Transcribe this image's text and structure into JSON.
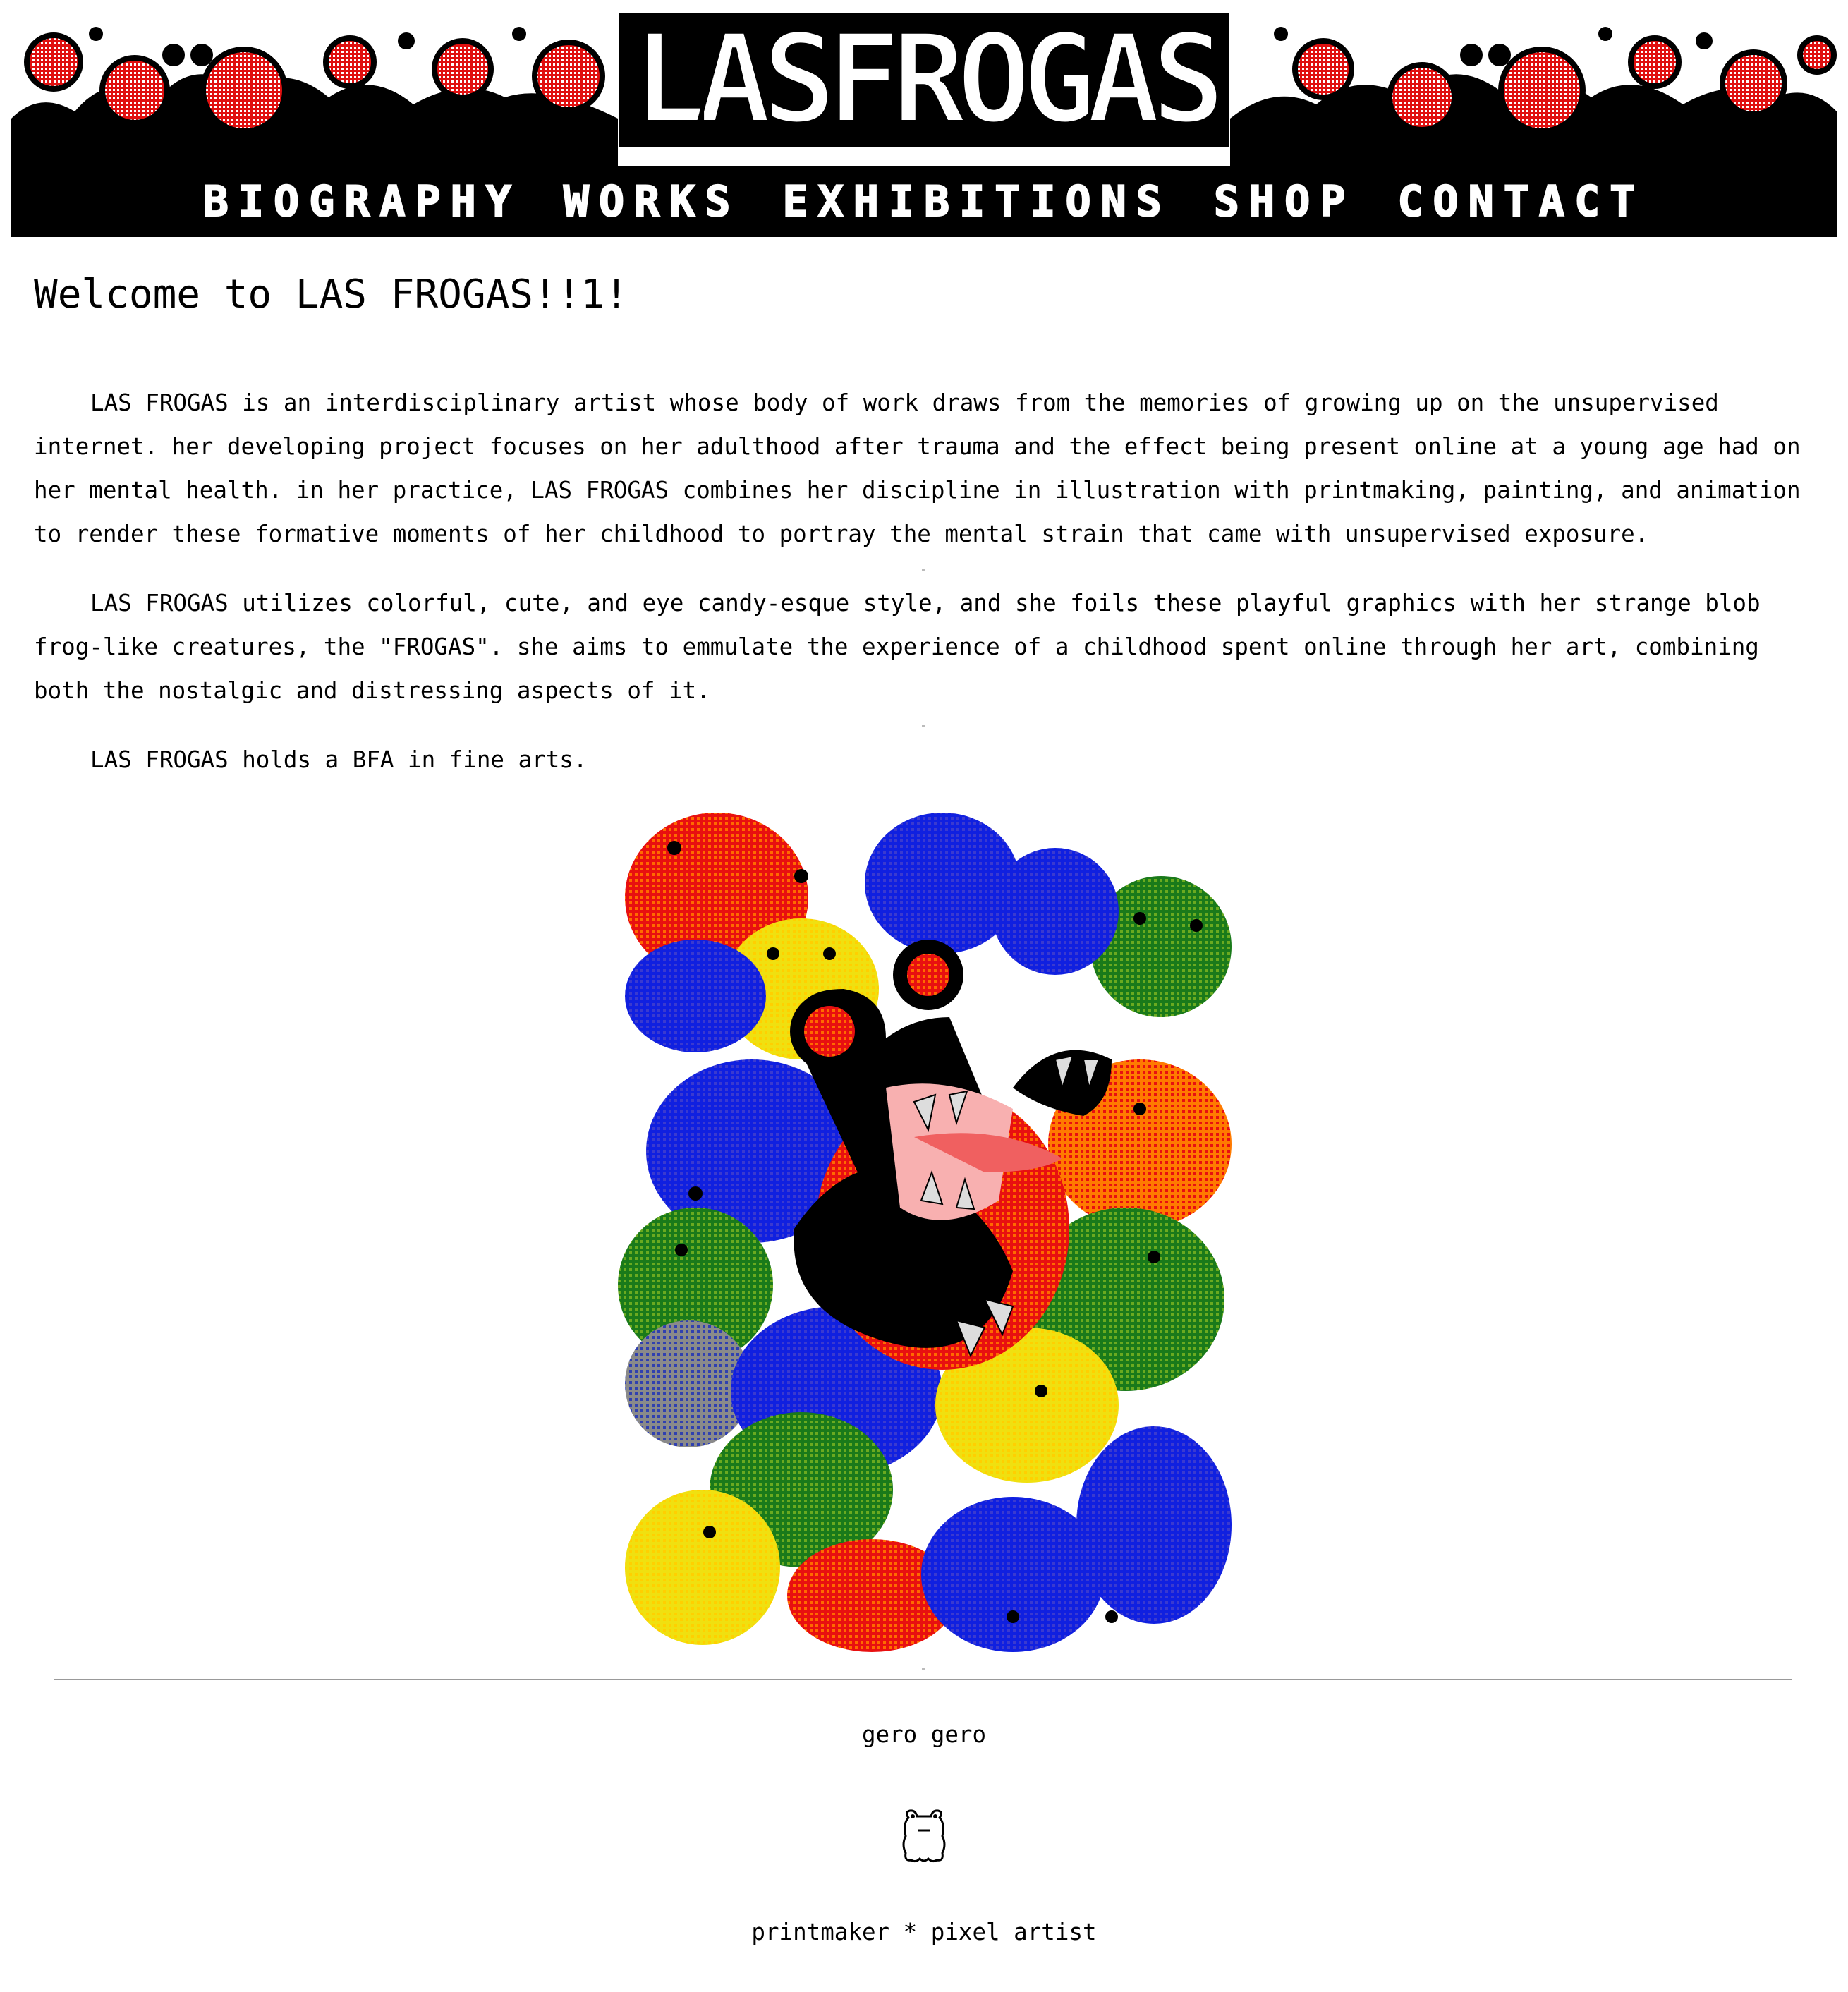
{
  "header": {
    "logo_text": "LASFROGAS",
    "nav": [
      "BIOGRAPHY",
      "WORKS",
      "EXHIBITIONS",
      "SHOP",
      "CONTACT"
    ],
    "colors": {
      "banner_black": "#000000",
      "banner_red": "#e01010"
    }
  },
  "main": {
    "title": "Welcome to LAS FROGAS!!1!",
    "paragraphs": [
      "LAS FROGAS is an interdisciplinary artist whose body of work draws from the memories of growing up on the unsupervised internet. her developing project focuses on her adulthood after trauma and the effect being present online at a young age had on her mental health. in her practice, LAS FROGAS combines her discipline in illustration with printmaking, painting, and animation to render these formative moments of her childhood to portray the mental strain that came with unsupervised exposure.",
      "LAS FROGAS utilizes colorful, cute, and eye candy-esque style, and she foils these playful graphics with her strange blob frog-like creatures, the \"FROGAS\". she aims to emmulate the experience of a childhood spent online through her art, combining both the nostalgic and distressing aspects of it.",
      "LAS FROGAS holds a BFA in fine arts."
    ]
  },
  "footer": {
    "tagline": "gero gero",
    "icon": "frog-icon",
    "roles": "printmaker * pixel artist"
  }
}
